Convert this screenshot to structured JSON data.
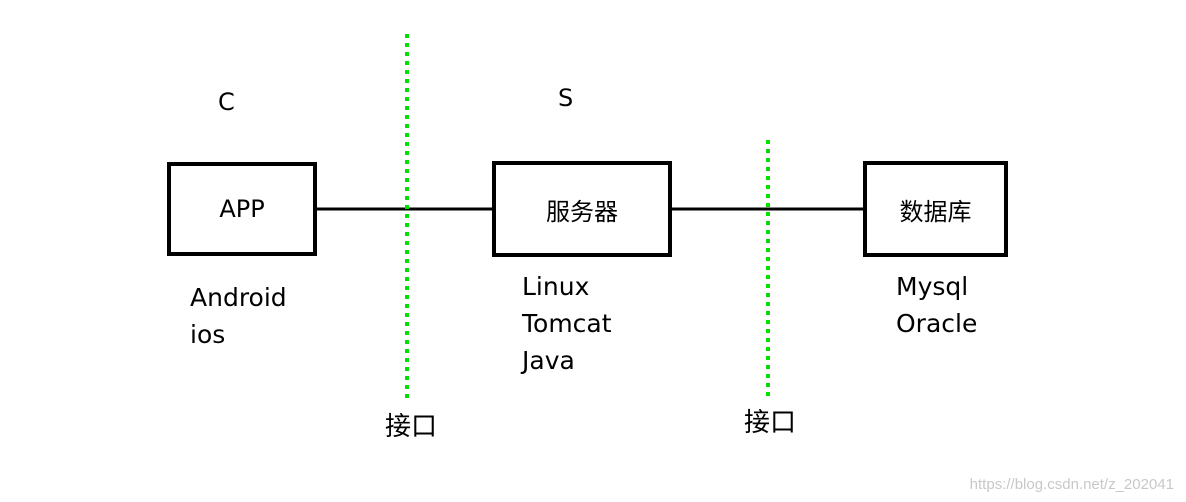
{
  "columns": {
    "client": "C",
    "server": "S"
  },
  "boxes": {
    "app": "APP",
    "server": "服务器",
    "database": "数据库"
  },
  "stacks": {
    "client": [
      "Android",
      "ios"
    ],
    "server": [
      "Linux",
      "Tomcat",
      "Java"
    ],
    "database": [
      "Mysql",
      "Oracle"
    ]
  },
  "interfaces": {
    "left": "接口",
    "right": "接口"
  },
  "colors": {
    "line": "#000000",
    "interface_dash": "#00e000",
    "watermark": "#c8c8c8"
  },
  "watermark": "https://blog.csdn.net/z_202041"
}
